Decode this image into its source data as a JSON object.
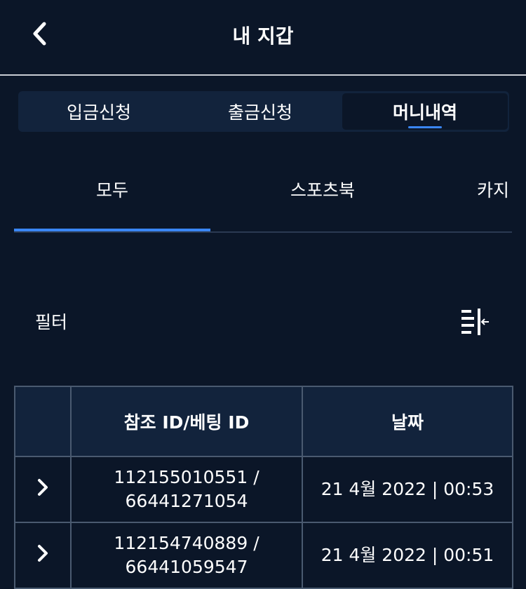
{
  "header": {
    "title": "내 지갑"
  },
  "segments": [
    {
      "label": "입금신청"
    },
    {
      "label": "출금신청"
    },
    {
      "label": "머니내역"
    }
  ],
  "tabs": [
    {
      "label": "모두"
    },
    {
      "label": "스포츠북"
    },
    {
      "label": "카지"
    }
  ],
  "filter": {
    "label": "필터"
  },
  "table": {
    "headers": [
      "",
      "참조 ID/베팅 ID",
      "날짜"
    ],
    "rows": [
      {
        "ref_line1": "112155010551 /",
        "ref_line2": "66441271054",
        "date": "21 4월 2022 | 00:53"
      },
      {
        "ref_line1": "112154740889 /",
        "ref_line2": "66441059547",
        "date": "21 4월 2022 | 00:51"
      }
    ]
  },
  "colors": {
    "background": "#0b1628",
    "accent": "#3a86f5",
    "panel": "#12233c"
  }
}
